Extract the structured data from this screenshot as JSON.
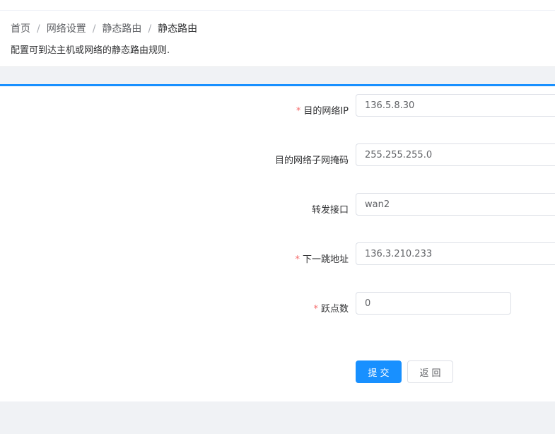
{
  "breadcrumb": {
    "items": [
      "首页",
      "网络设置",
      "静态路由",
      "静态路由"
    ],
    "separator": "/"
  },
  "description": "配置可到达主机或网络的静态路由规则.",
  "form": {
    "dest_ip": {
      "label": "目的网络IP",
      "required": true,
      "value": "136.5.8.30"
    },
    "dest_mask": {
      "label": "目的网络子网掩码",
      "required": false,
      "value": "255.255.255.0"
    },
    "interface": {
      "label": "转发接口",
      "required": false,
      "value": "wan2"
    },
    "next_hop": {
      "label": "下一跳地址",
      "required": true,
      "value": "136.3.210.233"
    },
    "hops": {
      "label": "跃点数",
      "required": true,
      "value": "0"
    },
    "required_mark": "*"
  },
  "actions": {
    "submit_label": "提交",
    "back_label": "返回"
  },
  "colors": {
    "primary": "#1890ff",
    "required": "#f56c6c",
    "page_bg": "#f0f2f5"
  }
}
